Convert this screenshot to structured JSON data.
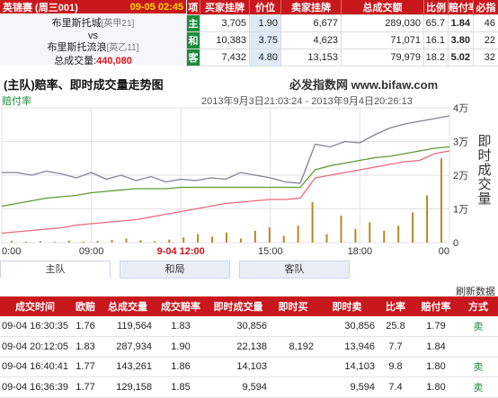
{
  "match": {
    "header_left": "英锦赛 (周三001)",
    "header_time": "09-05 02:45",
    "home": "布里斯托城",
    "home_league": "[英甲21]",
    "vs": "vs",
    "away": "布里斯托流浪",
    "away_league": "[英乙11]",
    "volume_label": "总成交量:",
    "volume_value": "440,080"
  },
  "market": {
    "headers": [
      "项",
      "买家挂牌",
      "价位",
      "卖家挂牌",
      "总成交额",
      "比例",
      "赔付率",
      "必指"
    ],
    "rows": [
      {
        "side": "主",
        "buy": "3,705",
        "price": "1.90",
        "sell": "6,677",
        "total": "289,030",
        "ratio": "65.7",
        "payout": "1.84",
        "idx": "46"
      },
      {
        "side": "和",
        "buy": "10,383",
        "price": "3.75",
        "sell": "4,623",
        "total": "71,071",
        "ratio": "16.1",
        "payout": "3.80",
        "idx": "22"
      },
      {
        "side": "客",
        "buy": "7,432",
        "price": "4.80",
        "sell": "13,153",
        "total": "79,979",
        "ratio": "18.2",
        "payout": "5.02",
        "idx": "32"
      }
    ]
  },
  "chart": {
    "title": "(主队)赔率、即时成交量走势图",
    "brand": "必发指数网 www.bifaw.com",
    "odds_label": "赔付率",
    "date_range": "2013年9月3日21:03:24 - 2013年9月4日20:26:13",
    "ylabel": "即时成交量",
    "colors": {
      "grey": "#7f8396",
      "green": "#5b9a33",
      "pink": "#e8697e",
      "bar": "#b5892a",
      "tick_red": "#c8171d"
    }
  },
  "chart_data": {
    "type": "line",
    "x_ticks": [
      "0:00",
      "09:00",
      "9-04 12:00",
      "15:00",
      "18:00",
      "00"
    ],
    "y_right_ticks": [
      "4万",
      "3万",
      "2万",
      "1万",
      "0"
    ],
    "ylim_right": [
      0,
      40000
    ],
    "x": [
      0,
      1,
      2,
      3,
      4,
      5,
      6,
      7,
      8,
      9,
      10,
      11,
      12,
      13,
      14,
      15,
      16,
      17,
      18,
      19,
      20,
      21,
      22,
      23,
      24,
      25,
      26,
      27,
      28,
      29,
      30
    ],
    "series": [
      {
        "color": "grey",
        "values": [
          0.52,
          0.52,
          0.5,
          0.53,
          0.51,
          0.48,
          0.52,
          0.47,
          0.5,
          0.46,
          0.49,
          0.45,
          0.47,
          0.46,
          0.48,
          0.47,
          0.52,
          0.5,
          0.48,
          0.45,
          0.44,
          0.73,
          0.71,
          0.75,
          0.74,
          0.8,
          0.85,
          0.88,
          0.9,
          0.92,
          0.94
        ]
      },
      {
        "color": "green",
        "values": [
          0.27,
          0.29,
          0.31,
          0.33,
          0.34,
          0.35,
          0.37,
          0.38,
          0.39,
          0.4,
          0.4,
          0.4,
          0.41,
          0.41,
          0.41,
          0.41,
          0.41,
          0.41,
          0.41,
          0.41,
          0.41,
          0.54,
          0.57,
          0.59,
          0.61,
          0.63,
          0.64,
          0.66,
          0.68,
          0.7,
          0.71
        ]
      },
      {
        "color": "pink",
        "values": [
          0.07,
          0.08,
          0.09,
          0.1,
          0.11,
          0.13,
          0.14,
          0.15,
          0.16,
          0.17,
          0.19,
          0.21,
          0.23,
          0.25,
          0.27,
          0.29,
          0.3,
          0.31,
          0.32,
          0.32,
          0.33,
          0.48,
          0.5,
          0.52,
          0.54,
          0.56,
          0.58,
          0.6,
          0.61,
          0.66,
          0.68
        ]
      }
    ],
    "volume": [
      500,
      300,
      400,
      200,
      600,
      300,
      500,
      800,
      1200,
      700,
      400,
      900,
      1500,
      2500,
      1800,
      3000,
      1200,
      3500,
      4500,
      2000,
      5000,
      12000,
      2500,
      8000,
      4000,
      6000,
      3500,
      5000,
      9000,
      14000,
      25000
    ]
  },
  "tabs": [
    "主队",
    "和局",
    "客队"
  ],
  "refresh": "刷新数据",
  "table": {
    "headers": [
      "成交时间",
      "欧赔",
      "总成交量",
      "成交赔率",
      "即时成交量",
      "即时买",
      "即时卖",
      "比率",
      "赔付率",
      "方式"
    ],
    "rows": [
      {
        "time": "09-04 16:30:35",
        "euro": "1.76",
        "total": "119,564",
        "odds": "1.83",
        "instant": "30,856",
        "buy": "",
        "sell": "30,856",
        "ratio": "25.8",
        "payout": "1.79",
        "mode": "卖"
      },
      {
        "time": "09-04 20:12:05",
        "euro": "1.83",
        "total": "287,934",
        "odds": "1.90",
        "instant": "22,138",
        "buy": "8,192",
        "sell": "13,946",
        "ratio": "7.7",
        "payout": "1.84",
        "mode": ""
      },
      {
        "time": "09-04 16:40:41",
        "euro": "1.77",
        "total": "143,261",
        "odds": "1.86",
        "instant": "14,103",
        "buy": "",
        "sell": "14,103",
        "ratio": "9.8",
        "payout": "1.80",
        "mode": "卖"
      },
      {
        "time": "09-04 16:36:39",
        "euro": "1.77",
        "total": "129,158",
        "odds": "1.85",
        "instant": "9,594",
        "buy": "",
        "sell": "9,594",
        "ratio": "7.4",
        "payout": "1.80",
        "mode": "卖"
      }
    ]
  }
}
